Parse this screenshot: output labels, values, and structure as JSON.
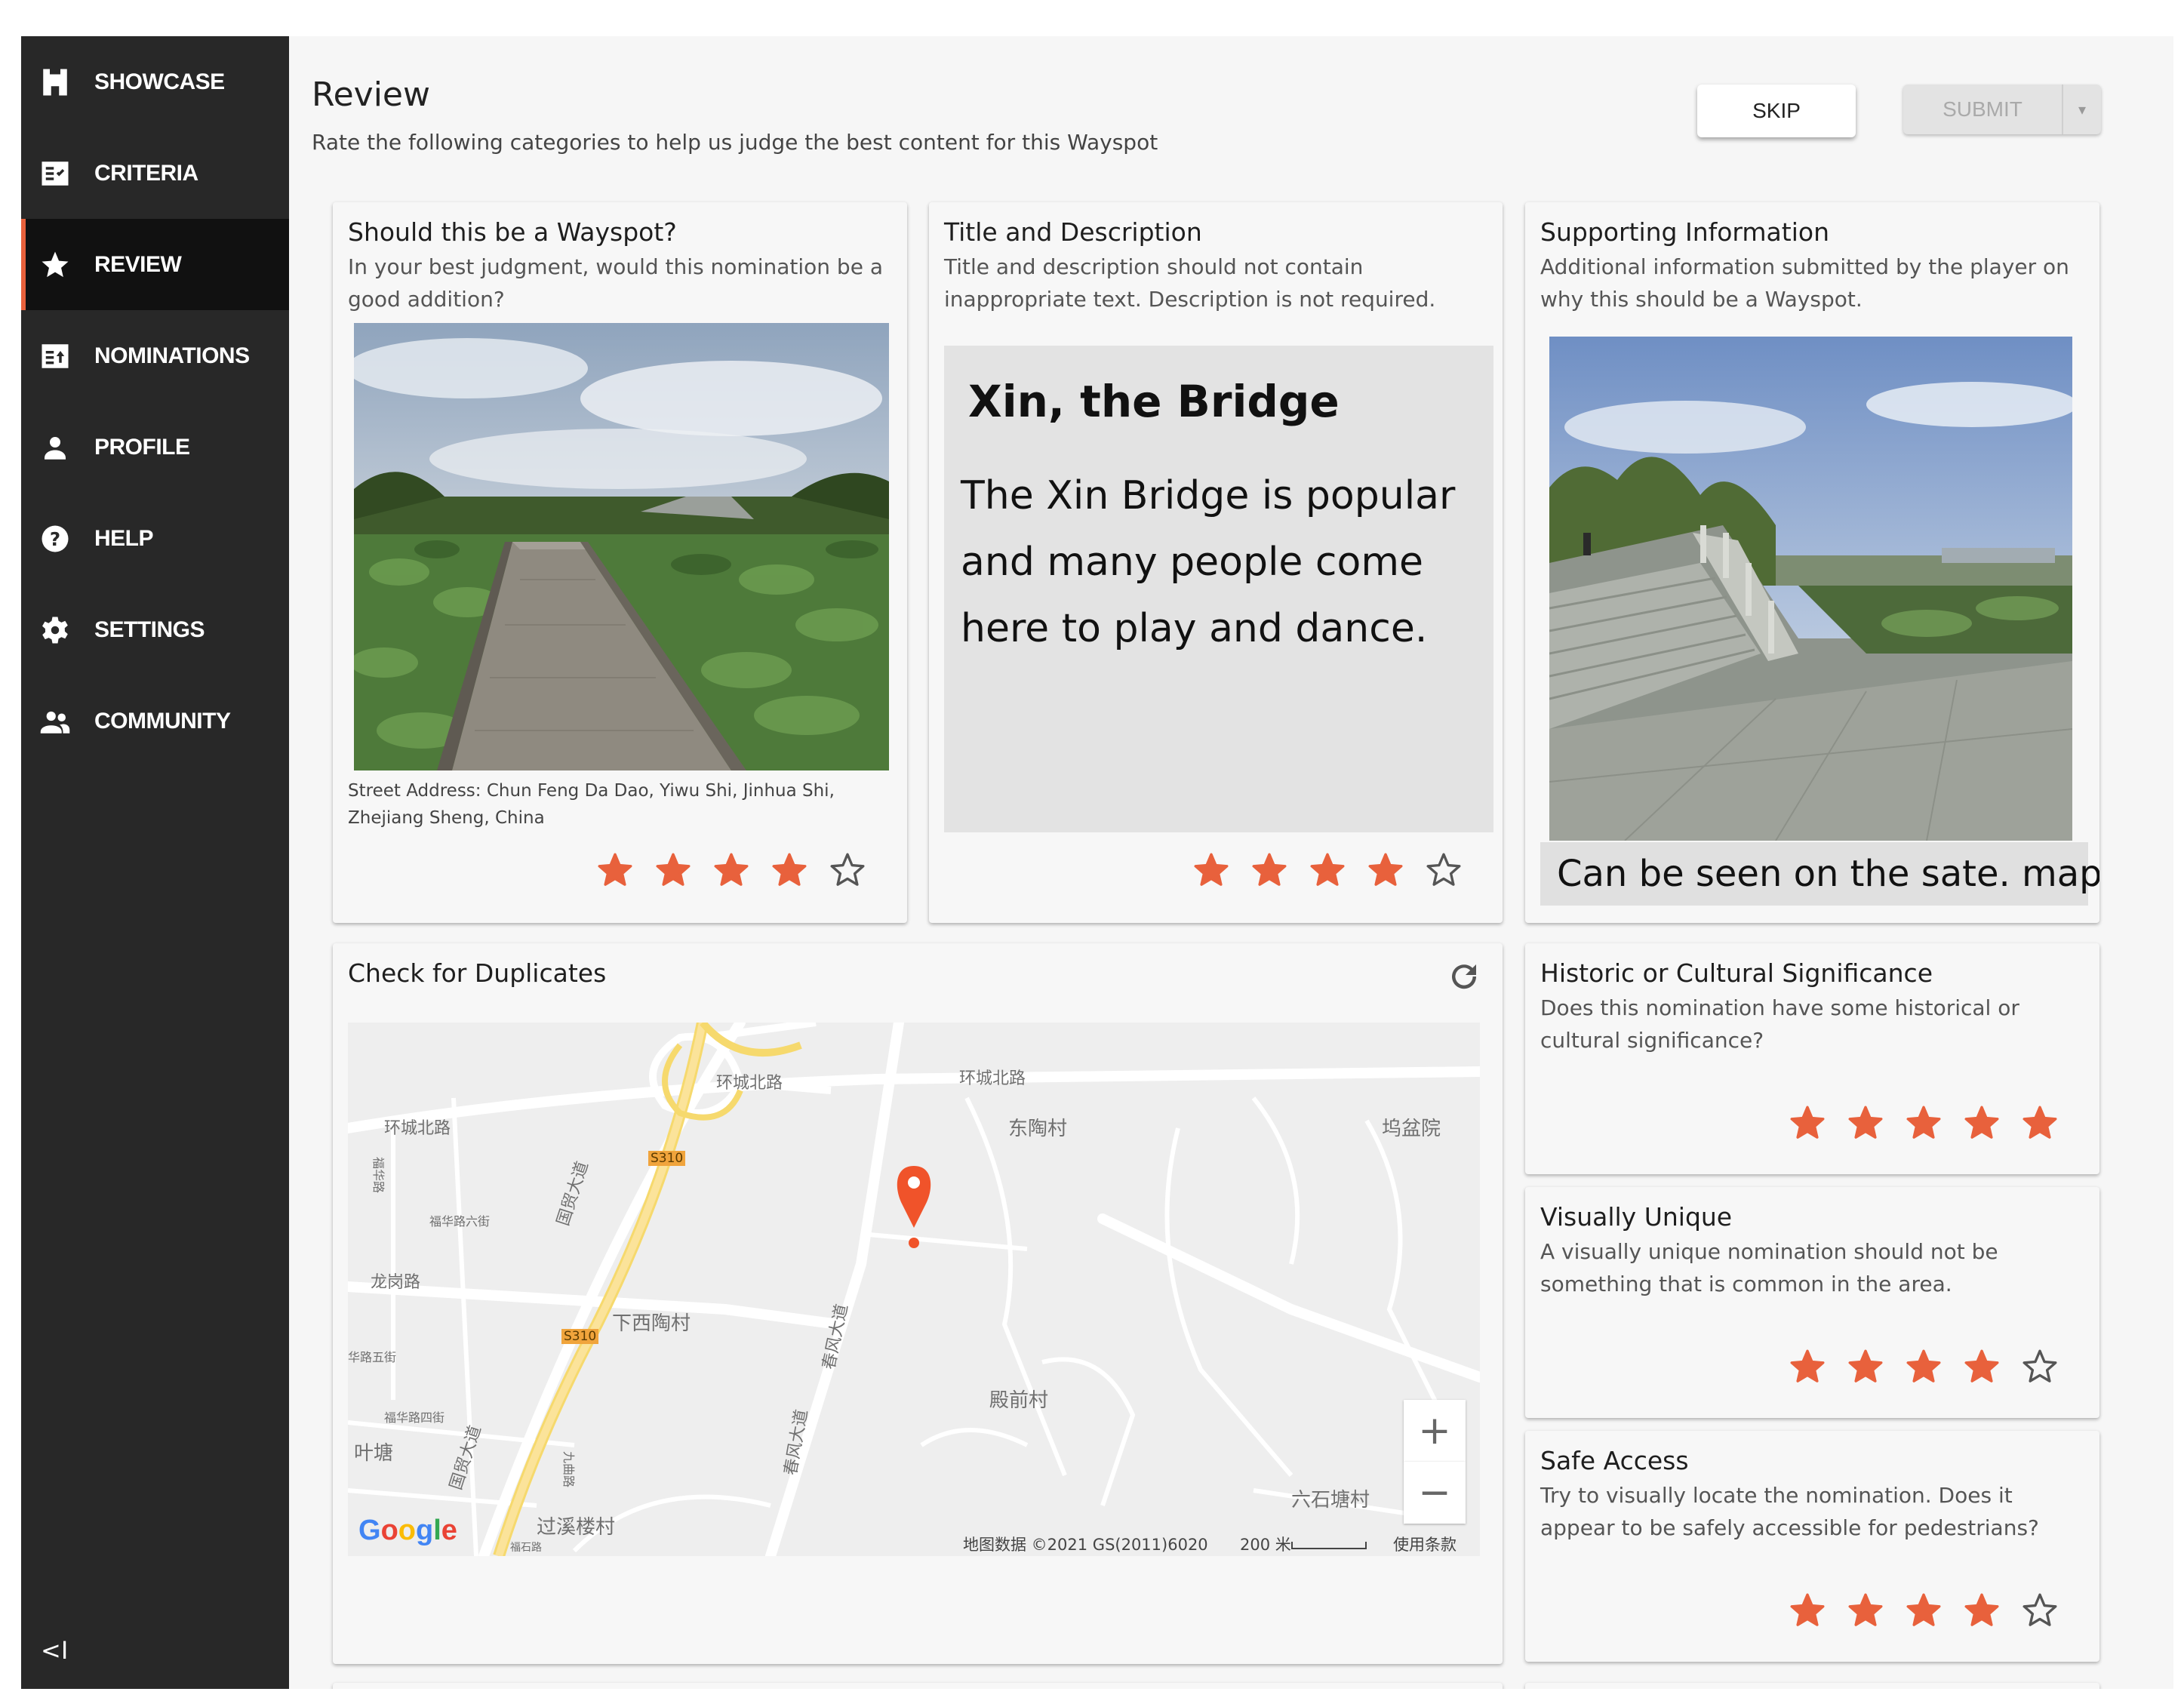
{
  "sidebar": {
    "items": [
      {
        "label": "SHOWCASE",
        "icon": "showcase-icon"
      },
      {
        "label": "CRITERIA",
        "icon": "criteria-icon"
      },
      {
        "label": "REVIEW",
        "icon": "star-icon",
        "active": true
      },
      {
        "label": "NOMINATIONS",
        "icon": "nominations-icon"
      },
      {
        "label": "PROFILE",
        "icon": "person-icon"
      },
      {
        "label": "HELP",
        "icon": "help-icon"
      },
      {
        "label": "SETTINGS",
        "icon": "gear-icon"
      },
      {
        "label": "COMMUNITY",
        "icon": "people-icon"
      }
    ],
    "collapse_label": "<I"
  },
  "header": {
    "title": "Review",
    "subtitle": "Rate the following categories to help us judge the best content for this Wayspot",
    "skip_label": "SKIP",
    "submit_label": "SUBMIT"
  },
  "cards": {
    "wayspot": {
      "title": "Should this be a Wayspot?",
      "description": "In your best judgment, would this nomination be a good addition?",
      "address": "Street Address: Chun Feng Da Dao, Yiwu Shi, Jinhua Shi, Zhejiang Sheng, China",
      "rating": 4,
      "max_rating": 5
    },
    "title_desc": {
      "title": "Title and Description",
      "description": "Title and description should not contain inappropriate text. Description is not required.",
      "nomination_title": "Xin, the Bridge",
      "nomination_description": "The Xin Bridge is popular and many people come here to play and dance.",
      "rating": 4,
      "max_rating": 5
    },
    "supporting": {
      "title": "Supporting Information",
      "description": "Additional information submitted by the player on why this should be a Wayspot.",
      "caption": "Can be seen on the sate. map"
    },
    "duplicates": {
      "title": "Check for Duplicates",
      "map": {
        "labels": {
          "ring_n1": "环城北路",
          "ring_n2": "环城北路",
          "ring_n3": "环城北路",
          "dongtao": "东陶村",
          "wupen": "坞盆院",
          "xixitao": "下西陶村",
          "dianqian": "殿前村",
          "liushitang": "六石塘村",
          "yetang": "叶塘",
          "guoxilou": "过溪楼村",
          "longgang": "龙岗路",
          "chunfeng1": "春风大道",
          "chunfeng2": "春风大道",
          "guomao1": "国贸大道",
          "guomao2": "国贸大道",
          "s310a": "S310",
          "s310b": "S310",
          "fuhua1": "福华路六街",
          "fuhua2": "福华路四街",
          "fuhua3": "华路五街",
          "fuhua4": "福华路",
          "jiuquan": "九曲路",
          "fushi": "福石路"
        },
        "attribution": "地图数据 ©2021 GS(2011)6020",
        "scale": "200 米",
        "terms": "使用条款",
        "zoom_in": "+",
        "zoom_out": "−",
        "logo": "Google"
      }
    },
    "historic": {
      "title": "Historic or Cultural Significance",
      "description": "Does this nomination have some historical or cultural significance?",
      "rating": 5,
      "max_rating": 5
    },
    "unique": {
      "title": "Visually Unique",
      "description": "A visually unique nomination should not be something that is common in the area.",
      "rating": 4,
      "max_rating": 5
    },
    "safe": {
      "title": "Safe Access",
      "description": "Try to visually locate the nomination. Does it appear to be safely accessible for pedestrians?",
      "rating": 4,
      "max_rating": 5
    }
  },
  "colors": {
    "star": "#e8613c",
    "sidebar": "#282828",
    "active_accent": "#e8613c",
    "map_pin": "#f0532a",
    "highway": "#fadd7a"
  }
}
